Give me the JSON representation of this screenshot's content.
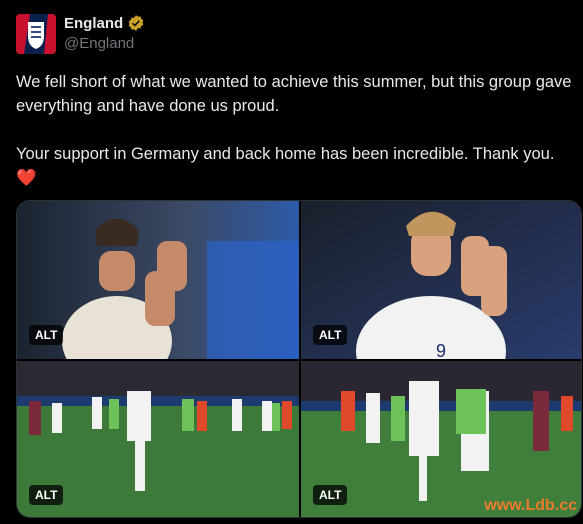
{
  "account": {
    "display_name": "England",
    "handle": "@England",
    "verified": true,
    "verified_color": "#c9a227",
    "avatar_icon": "england-crest-icon"
  },
  "tweet": {
    "paragraph1": "We fell short of what we wanted to achieve this summer, but this group gave everything and have done us proud.",
    "paragraph2": "Your support in Germany and back home has been incredible. Thank you.",
    "emoji": "❤️"
  },
  "media": {
    "photos": [
      {
        "alt_label": "ALT"
      },
      {
        "alt_label": "ALT"
      },
      {
        "alt_label": "ALT"
      },
      {
        "alt_label": "ALT"
      }
    ],
    "watermark": "www.Ldb.cc"
  },
  "colors": {
    "background": "#000000",
    "text": "#e7e9ea",
    "secondary_text": "#71767b",
    "heart": "#f91880"
  }
}
